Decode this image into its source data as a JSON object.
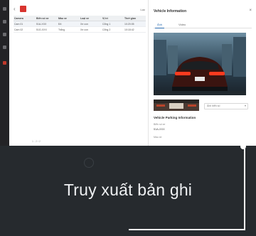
{
  "list": {
    "back_icon": "arrow-left-icon",
    "actions_label": "Lọc",
    "columns": [
      "Camera",
      "Biển số xe",
      "Màu xe",
      "Loại xe",
      "Vị trí",
      "Thời gian"
    ],
    "rows": [
      [
        "Cam 01",
        "51A-XXX",
        "Đỏ",
        "Xe con",
        "Cổng 1",
        "10:20:05"
      ],
      [
        "Cam 02",
        "51G-XXX",
        "Trắng",
        "Xe con",
        "Cổng 2",
        "10:18:42"
      ]
    ],
    "pager": "1 - 2 / 2"
  },
  "panel": {
    "title": "Vehicle Information",
    "tabs": [
      "Ảnh",
      "Video"
    ],
    "thumb_select": "Ảnh biển số",
    "section_title": "Vehicle Parking Information",
    "field1_label": "Biển số xe",
    "field1_value": "51A-XXX",
    "field2_label": "Màu xe"
  },
  "caption": "Truy xuất bản ghi",
  "colors": {
    "accent": "#d8342f",
    "link": "#2b6cb0",
    "bottom_bg": "#262a2e"
  }
}
